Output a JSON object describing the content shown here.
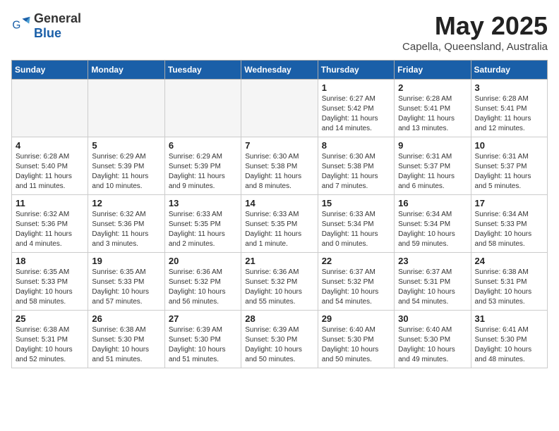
{
  "header": {
    "logo_general": "General",
    "logo_blue": "Blue",
    "title": "May 2025",
    "subtitle": "Capella, Queensland, Australia"
  },
  "days_of_week": [
    "Sunday",
    "Monday",
    "Tuesday",
    "Wednesday",
    "Thursday",
    "Friday",
    "Saturday"
  ],
  "weeks": [
    [
      {
        "day": "",
        "info": ""
      },
      {
        "day": "",
        "info": ""
      },
      {
        "day": "",
        "info": ""
      },
      {
        "day": "",
        "info": ""
      },
      {
        "day": "1",
        "info": "Sunrise: 6:27 AM\nSunset: 5:42 PM\nDaylight: 11 hours\nand 14 minutes."
      },
      {
        "day": "2",
        "info": "Sunrise: 6:28 AM\nSunset: 5:41 PM\nDaylight: 11 hours\nand 13 minutes."
      },
      {
        "day": "3",
        "info": "Sunrise: 6:28 AM\nSunset: 5:41 PM\nDaylight: 11 hours\nand 12 minutes."
      }
    ],
    [
      {
        "day": "4",
        "info": "Sunrise: 6:28 AM\nSunset: 5:40 PM\nDaylight: 11 hours\nand 11 minutes."
      },
      {
        "day": "5",
        "info": "Sunrise: 6:29 AM\nSunset: 5:39 PM\nDaylight: 11 hours\nand 10 minutes."
      },
      {
        "day": "6",
        "info": "Sunrise: 6:29 AM\nSunset: 5:39 PM\nDaylight: 11 hours\nand 9 minutes."
      },
      {
        "day": "7",
        "info": "Sunrise: 6:30 AM\nSunset: 5:38 PM\nDaylight: 11 hours\nand 8 minutes."
      },
      {
        "day": "8",
        "info": "Sunrise: 6:30 AM\nSunset: 5:38 PM\nDaylight: 11 hours\nand 7 minutes."
      },
      {
        "day": "9",
        "info": "Sunrise: 6:31 AM\nSunset: 5:37 PM\nDaylight: 11 hours\nand 6 minutes."
      },
      {
        "day": "10",
        "info": "Sunrise: 6:31 AM\nSunset: 5:37 PM\nDaylight: 11 hours\nand 5 minutes."
      }
    ],
    [
      {
        "day": "11",
        "info": "Sunrise: 6:32 AM\nSunset: 5:36 PM\nDaylight: 11 hours\nand 4 minutes."
      },
      {
        "day": "12",
        "info": "Sunrise: 6:32 AM\nSunset: 5:36 PM\nDaylight: 11 hours\nand 3 minutes."
      },
      {
        "day": "13",
        "info": "Sunrise: 6:33 AM\nSunset: 5:35 PM\nDaylight: 11 hours\nand 2 minutes."
      },
      {
        "day": "14",
        "info": "Sunrise: 6:33 AM\nSunset: 5:35 PM\nDaylight: 11 hours\nand 1 minute."
      },
      {
        "day": "15",
        "info": "Sunrise: 6:33 AM\nSunset: 5:34 PM\nDaylight: 11 hours\nand 0 minutes."
      },
      {
        "day": "16",
        "info": "Sunrise: 6:34 AM\nSunset: 5:34 PM\nDaylight: 10 hours\nand 59 minutes."
      },
      {
        "day": "17",
        "info": "Sunrise: 6:34 AM\nSunset: 5:33 PM\nDaylight: 10 hours\nand 58 minutes."
      }
    ],
    [
      {
        "day": "18",
        "info": "Sunrise: 6:35 AM\nSunset: 5:33 PM\nDaylight: 10 hours\nand 58 minutes."
      },
      {
        "day": "19",
        "info": "Sunrise: 6:35 AM\nSunset: 5:33 PM\nDaylight: 10 hours\nand 57 minutes."
      },
      {
        "day": "20",
        "info": "Sunrise: 6:36 AM\nSunset: 5:32 PM\nDaylight: 10 hours\nand 56 minutes."
      },
      {
        "day": "21",
        "info": "Sunrise: 6:36 AM\nSunset: 5:32 PM\nDaylight: 10 hours\nand 55 minutes."
      },
      {
        "day": "22",
        "info": "Sunrise: 6:37 AM\nSunset: 5:32 PM\nDaylight: 10 hours\nand 54 minutes."
      },
      {
        "day": "23",
        "info": "Sunrise: 6:37 AM\nSunset: 5:31 PM\nDaylight: 10 hours\nand 54 minutes."
      },
      {
        "day": "24",
        "info": "Sunrise: 6:38 AM\nSunset: 5:31 PM\nDaylight: 10 hours\nand 53 minutes."
      }
    ],
    [
      {
        "day": "25",
        "info": "Sunrise: 6:38 AM\nSunset: 5:31 PM\nDaylight: 10 hours\nand 52 minutes."
      },
      {
        "day": "26",
        "info": "Sunrise: 6:38 AM\nSunset: 5:30 PM\nDaylight: 10 hours\nand 51 minutes."
      },
      {
        "day": "27",
        "info": "Sunrise: 6:39 AM\nSunset: 5:30 PM\nDaylight: 10 hours\nand 51 minutes."
      },
      {
        "day": "28",
        "info": "Sunrise: 6:39 AM\nSunset: 5:30 PM\nDaylight: 10 hours\nand 50 minutes."
      },
      {
        "day": "29",
        "info": "Sunrise: 6:40 AM\nSunset: 5:30 PM\nDaylight: 10 hours\nand 50 minutes."
      },
      {
        "day": "30",
        "info": "Sunrise: 6:40 AM\nSunset: 5:30 PM\nDaylight: 10 hours\nand 49 minutes."
      },
      {
        "day": "31",
        "info": "Sunrise: 6:41 AM\nSunset: 5:30 PM\nDaylight: 10 hours\nand 48 minutes."
      }
    ]
  ]
}
